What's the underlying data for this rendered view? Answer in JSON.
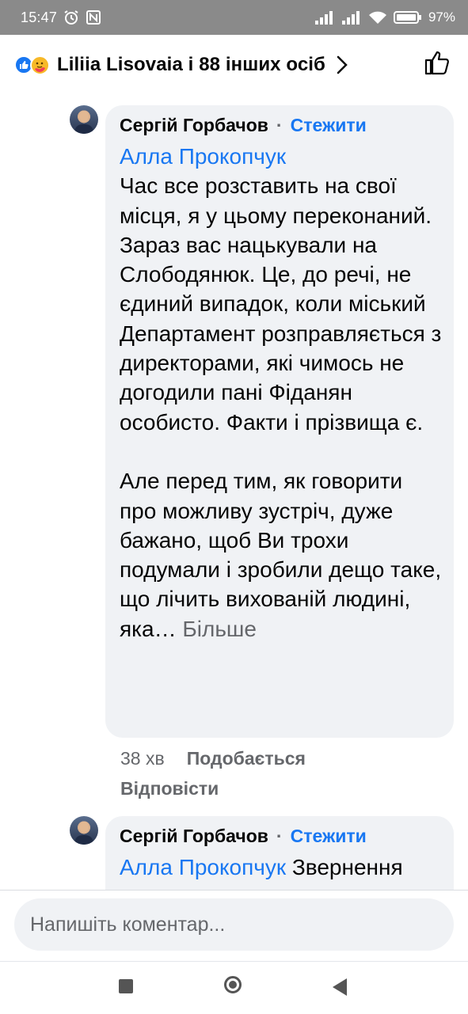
{
  "status_bar": {
    "time": "15:47",
    "battery": "97"
  },
  "header": {
    "title": "Liliia Lisovaia і 88 інших осіб"
  },
  "comments": [
    {
      "author": "Сергій Горбачов",
      "follow_label": "Стежити",
      "mention": "Алла Прокопчук",
      "text": "Час все розставить на свої місця, я у цьому переконаний.\nЗараз вас нацькували на Слободянюк. Це, до речі, не єдиний випадок, коли міський Департамент розправляється з директорами, які чимось не догодили пані Фіданян особисто. Факти і прізвища є.\n\nАле перед тим, як говорити про можливу зустріч, дуже бажано, щоб Ви трохи подумали і зробили дещо таке, що лічить вихованій людині, яка…",
      "more_label": "Більше",
      "time": "38 хв",
      "like_label": "Подобається",
      "reply_label": "Відповісти"
    },
    {
      "author": "Сергій Горбачов",
      "follow_label": "Стежити",
      "mention": "Алла Прокопчук",
      "text": "Звернення"
    }
  ],
  "composer": {
    "placeholder": "Напишіть коментар..."
  }
}
